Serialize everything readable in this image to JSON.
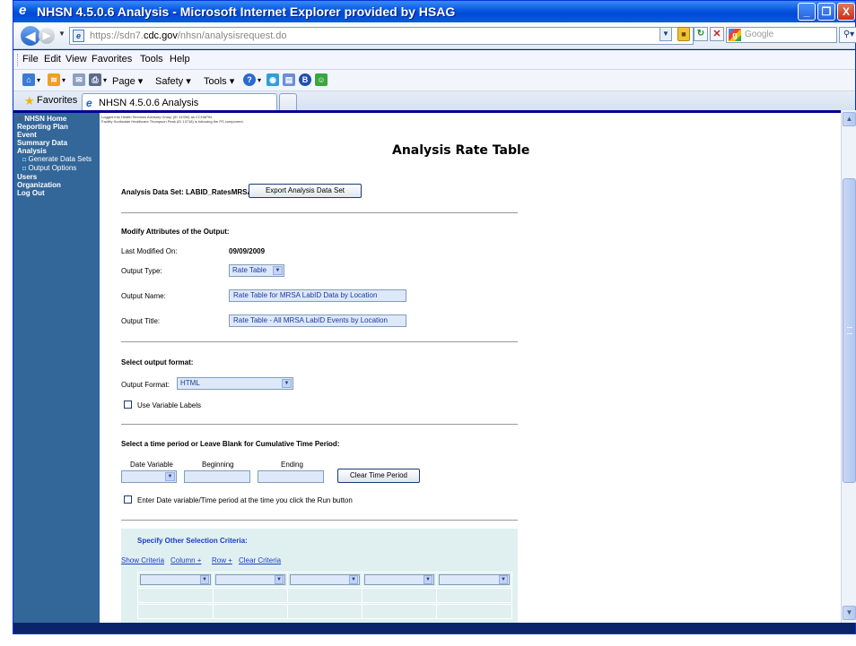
{
  "window": {
    "title": "NHSN 4.5.0.6 Analysis - Microsoft Internet Explorer provided by HSAG",
    "min_glyph": "_",
    "max_glyph": "❐",
    "close_glyph": "X"
  },
  "address": {
    "url_prefix": "https://sdn7.",
    "url_domain": "cdc.gov",
    "url_suffix": "/nhsn/analysisrequest.do",
    "search_placeholder": "Google"
  },
  "menu": [
    "File",
    "Edit",
    "View",
    "Favorites",
    "Tools",
    "Help"
  ],
  "commands": {
    "page": "Page ▾",
    "safety": "Safety ▾",
    "tools": "Tools ▾"
  },
  "tabs": {
    "favorites_label": "Favorites",
    "active_tab": "NHSN 4.5.0.6 Analysis"
  },
  "sidebar": {
    "items": [
      {
        "label": "NHSN Home"
      },
      {
        "label": "Reporting Plan"
      },
      {
        "label": "Event"
      },
      {
        "label": "Summary Data"
      },
      {
        "label": "Analysis"
      },
      {
        "label": "Generate Data Sets"
      },
      {
        "label": "Output Options"
      },
      {
        "label": "Users"
      },
      {
        "label": "Organization"
      },
      {
        "label": "Log Out"
      }
    ]
  },
  "main": {
    "logged_line1": "Logged into Health Services Advisory Group (ID 14330) as CCHAPIN.",
    "logged_line2": "Facility Scottsdale Healthcare Thompson Peak (ID 13718) is following the PS component.",
    "title": "Analysis Rate Table",
    "dataset_label": "Analysis Data Set: LABID_RatesMRSA",
    "export_button": "Export Analysis Data Set",
    "modify_heading": "Modify Attributes of the Output:",
    "last_modified_label": "Last Modified On:",
    "last_modified_value": "09/09/2009",
    "output_type_label": "Output Type:",
    "output_type_value": "Rate Table",
    "output_name_label": "Output Name:",
    "output_name_value": "Rate Table for MRSA LabID Data by Location",
    "output_title_label": "Output Title:",
    "output_title_value": "Rate Table - All MRSA LabID Events by Location",
    "format_heading": "Select output format:",
    "output_format_label": "Output Format:",
    "output_format_value": "HTML",
    "use_labels": "Use Variable Labels",
    "time_heading": "Select a time period or Leave Blank for Cumulative Time Period:",
    "date_variable_label": "Date Variable",
    "beginning_label": "Beginning",
    "ending_label": "Ending",
    "clear_time_button": "Clear Time Period",
    "enter_date_label": "Enter Date variable/Time period at the time you click the Run button",
    "criteria_heading": "Specify Other Selection Criteria:",
    "show_criteria": "Show Criteria",
    "column_plus": "Column +",
    "row_plus": "Row +",
    "clear_criteria": "Clear Criteria"
  }
}
